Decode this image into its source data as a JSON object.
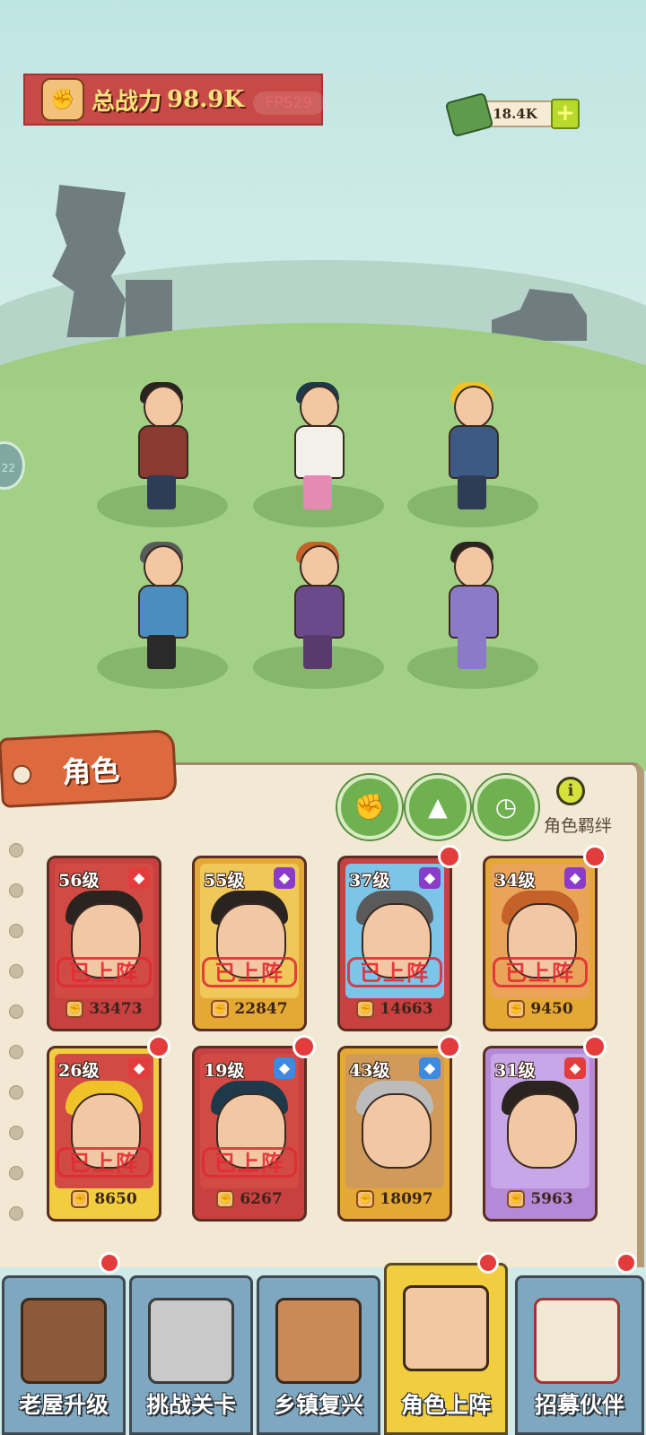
{
  "hud": {
    "power_label": "总战力",
    "power_value": "98.9K",
    "fps": "FPS29",
    "cash": "18.4K",
    "cash_plus": "+",
    "side_counter": "22"
  },
  "panel": {
    "tab_title": "角色",
    "bond_label": "角色羁绊",
    "info_symbol": "i"
  },
  "cards": [
    {
      "level": "56级",
      "power": "33473",
      "status": "已上阵",
      "frame": "#c84140",
      "bg": "#d24a44",
      "gem": "#e23c3c",
      "hair": "#2b2320"
    },
    {
      "level": "55级",
      "power": "22847",
      "status": "已上阵",
      "frame": "#e4a934",
      "bg": "#f0c85a",
      "gem": "#8a3cc8",
      "hair": "#2b2320"
    },
    {
      "level": "37级",
      "power": "14663",
      "status": "已上阵",
      "frame": "#c84140",
      "bg": "#7cc4e8",
      "gem": "#8a3cc8",
      "hair": "#5a5a5a"
    },
    {
      "level": "34级",
      "power": "9450",
      "status": "已上阵",
      "frame": "#e4a934",
      "bg": "#e9a45a",
      "gem": "#8a3cc8",
      "hair": "#c4622a"
    },
    {
      "level": "26级",
      "power": "8650",
      "status": "已上阵",
      "frame": "#f1cd3f",
      "bg": "#d24a44",
      "gem": "#e23c3c",
      "hair": "#f0c22a"
    },
    {
      "level": "19级",
      "power": "6267",
      "status": "已上阵",
      "frame": "#c84140",
      "bg": "#d24a44",
      "gem": "#3c8ae2",
      "hair": "#1e3a4a"
    },
    {
      "level": "43级",
      "power": "18097",
      "status": "",
      "frame": "#e4a934",
      "bg": "#cf9a5a",
      "gem": "#3c8ae2",
      "hair": "#bcbcbc"
    },
    {
      "level": "31级",
      "power": "5963",
      "status": "",
      "frame": "#b48ad8",
      "bg": "#c9a6e8",
      "gem": "#e23c3c",
      "hair": "#2b2320"
    }
  ],
  "nav": [
    {
      "label": "老屋升级",
      "icon": "house-icon"
    },
    {
      "label": "挑战关卡",
      "icon": "chainsaw-icon"
    },
    {
      "label": "乡镇复兴",
      "icon": "market-icon"
    },
    {
      "label": "角色上阵",
      "icon": "characters-icon"
    },
    {
      "label": "招募伙伴",
      "icon": "recruit-icon"
    }
  ],
  "colors": {
    "accent_red": "#e23c3c",
    "power_yellow": "#f7e27c",
    "nav_blue": "#7fa8c0",
    "nav_active": "#f1cd3f"
  }
}
